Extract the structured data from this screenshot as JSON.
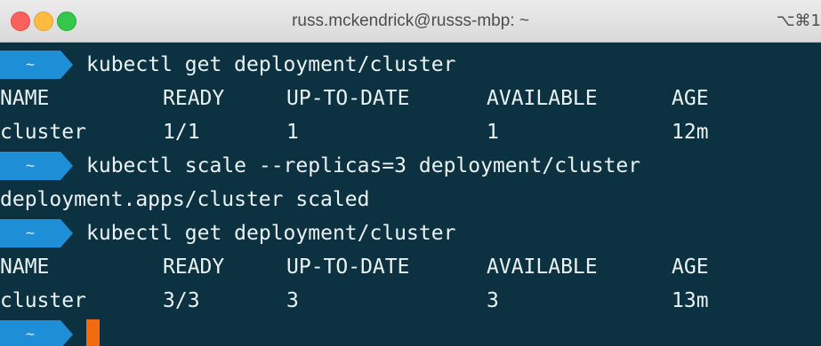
{
  "window": {
    "title": "russ.mckendrick@russs-mbp: ~",
    "shortcut": "⌥⌘1"
  },
  "prompt": {
    "directory": "~"
  },
  "commands": [
    "kubectl get deployment/cluster",
    "kubectl scale --replicas=3 deployment/cluster",
    "kubectl get deployment/cluster"
  ],
  "table_headers": [
    "NAME",
    "READY",
    "UP-TO-DATE",
    "AVAILABLE",
    "AGE"
  ],
  "first_output": [
    "cluster",
    "1/1",
    "1",
    "1",
    "12m"
  ],
  "scale_output": "deployment.apps/cluster scaled",
  "second_output": [
    "cluster",
    "3/3",
    "3",
    "3",
    "13m"
  ],
  "colors": {
    "terminal_background": "#0c3140",
    "prompt_badge": "#1e8fd6",
    "cursor": "#f26b10",
    "text": "#eaf2f3"
  }
}
